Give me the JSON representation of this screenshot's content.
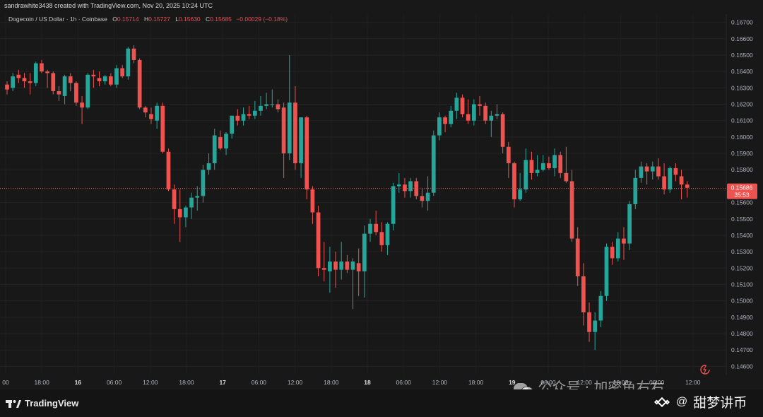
{
  "header": {
    "credit": "sandrawhite3438 created with TradingView.com, Nov 20, 2025 10:24 UTC"
  },
  "legend": {
    "symbol": "Dogecoin / US Dollar · 1h · Coinbase",
    "o_label": "O",
    "o_value": "0.15714",
    "h_label": "H",
    "h_value": "0.15727",
    "l_label": "L",
    "l_value": "0.15630",
    "c_label": "C",
    "c_value": "0.15685",
    "change": "−0.00029 (−0.18%)"
  },
  "price_axis": {
    "ticks": [
      "0.16700",
      "0.16600",
      "0.16500",
      "0.16400",
      "0.16300",
      "0.16200",
      "0.16100",
      "0.16000",
      "0.15900",
      "0.15800",
      "0.15600",
      "0.15500",
      "0.15400",
      "0.15300",
      "0.15200",
      "0.15100",
      "0.15000",
      "0.14900",
      "0.14800",
      "0.14700",
      "0.14600"
    ],
    "current_price": "0.15686",
    "countdown": "35:53"
  },
  "time_axis": {
    "ticks": [
      "00",
      "18:00",
      "16",
      "06:00",
      "12:00",
      "18:00",
      "17",
      "06:00",
      "12:00",
      "18:00",
      "18",
      "06:00",
      "12:00",
      "18:00",
      "19",
      "06:00",
      "12:00",
      "18:00",
      "06:00",
      "12:00"
    ]
  },
  "footer": {
    "brand": "TradingView"
  },
  "watermarks": {
    "wechat_text": "公众号 · 加密鱼右右",
    "channel_text": "甜梦讲币"
  },
  "colors": {
    "up": "#26a69a",
    "down": "#ef5350",
    "background": "#181818",
    "price_line": "#ef5350"
  },
  "chart_data": {
    "type": "candlestick",
    "title": "Dogecoin / US Dollar · 1h · Coinbase",
    "ylim": [
      0.1455,
      0.1675
    ],
    "current_price": 0.15686,
    "series": [
      {
        "ohlc": [
          [
            0.1632,
            0.1634,
            0.1626,
            0.1629
          ],
          [
            0.163,
            0.1639,
            0.1628,
            0.1637
          ],
          [
            0.1638,
            0.1641,
            0.1633,
            0.1636
          ],
          [
            0.1636,
            0.1639,
            0.163,
            0.1634
          ],
          [
            0.1634,
            0.1639,
            0.1626,
            0.1633
          ],
          [
            0.1633,
            0.1646,
            0.1631,
            0.1645
          ],
          [
            0.1645,
            0.1647,
            0.1639,
            0.164
          ],
          [
            0.164,
            0.1641,
            0.163,
            0.1639
          ],
          [
            0.1639,
            0.164,
            0.1626,
            0.1628
          ],
          [
            0.1628,
            0.1631,
            0.1622,
            0.1626
          ],
          [
            0.1625,
            0.1638,
            0.162,
            0.1637
          ],
          [
            0.1637,
            0.1639,
            0.1628,
            0.1633
          ],
          [
            0.1633,
            0.1634,
            0.1619,
            0.1621
          ],
          [
            0.1621,
            0.1625,
            0.1608,
            0.1618
          ],
          [
            0.1618,
            0.1639,
            0.1617,
            0.1638
          ],
          [
            0.1638,
            0.1641,
            0.163,
            0.1637
          ],
          [
            0.1636,
            0.164,
            0.1631,
            0.1634
          ],
          [
            0.1634,
            0.1638,
            0.1632,
            0.1637
          ],
          [
            0.1637,
            0.1639,
            0.1631,
            0.1632
          ],
          [
            0.1632,
            0.1644,
            0.163,
            0.1642
          ],
          [
            0.1642,
            0.1644,
            0.1636,
            0.1637
          ],
          [
            0.1637,
            0.1655,
            0.1635,
            0.1654
          ],
          [
            0.1654,
            0.1656,
            0.1645,
            0.1647
          ],
          [
            0.1647,
            0.1648,
            0.1617,
            0.1618
          ],
          [
            0.1618,
            0.1619,
            0.1612,
            0.1615
          ],
          [
            0.1614,
            0.1618,
            0.1608,
            0.1611
          ],
          [
            0.161,
            0.1621,
            0.1605,
            0.1619
          ],
          [
            0.1619,
            0.1621,
            0.159,
            0.1591
          ],
          [
            0.1591,
            0.1593,
            0.1567,
            0.1568
          ],
          [
            0.1568,
            0.1571,
            0.1547,
            0.1556
          ],
          [
            0.1556,
            0.1568,
            0.1536,
            0.1551
          ],
          [
            0.1551,
            0.1558,
            0.1545,
            0.1557
          ],
          [
            0.1557,
            0.1566,
            0.155,
            0.1563
          ],
          [
            0.1563,
            0.157,
            0.1555,
            0.1564
          ],
          [
            0.1564,
            0.1583,
            0.156,
            0.158
          ],
          [
            0.158,
            0.159,
            0.1577,
            0.1584
          ],
          [
            0.1584,
            0.1605,
            0.158,
            0.1601
          ],
          [
            0.16,
            0.1604,
            0.1592,
            0.1593
          ],
          [
            0.1593,
            0.1603,
            0.1589,
            0.1602
          ],
          [
            0.1602,
            0.1613,
            0.1599,
            0.1613
          ],
          [
            0.1613,
            0.1617,
            0.1607,
            0.161
          ],
          [
            0.161,
            0.1618,
            0.1607,
            0.1614
          ],
          [
            0.1614,
            0.1619,
            0.1611,
            0.1613
          ],
          [
            0.1613,
            0.1622,
            0.1611,
            0.1616
          ],
          [
            0.1616,
            0.1625,
            0.1613,
            0.1619
          ],
          [
            0.1619,
            0.1627,
            0.1617,
            0.162
          ],
          [
            0.162,
            0.1629,
            0.1618,
            0.162
          ],
          [
            0.162,
            0.1623,
            0.1615,
            0.1617
          ],
          [
            0.1618,
            0.1621,
            0.1575,
            0.159
          ],
          [
            0.159,
            0.165,
            0.1586,
            0.1621
          ],
          [
            0.1621,
            0.1631,
            0.158,
            0.1584
          ],
          [
            0.1584,
            0.1612,
            0.1575,
            0.1612
          ],
          [
            0.1612,
            0.1613,
            0.1562,
            0.1568
          ],
          [
            0.1568,
            0.157,
            0.1547,
            0.1554
          ],
          [
            0.1554,
            0.1558,
            0.1515,
            0.152
          ],
          [
            0.152,
            0.1536,
            0.1512,
            0.1519
          ],
          [
            0.1518,
            0.1533,
            0.1505,
            0.1524
          ],
          [
            0.1524,
            0.153,
            0.1508,
            0.1519
          ],
          [
            0.1519,
            0.1536,
            0.1513,
            0.1524
          ],
          [
            0.1524,
            0.1528,
            0.1517,
            0.1519
          ],
          [
            0.1519,
            0.1526,
            0.1495,
            0.1524
          ],
          [
            0.1523,
            0.1532,
            0.1503,
            0.1518
          ],
          [
            0.1518,
            0.1546,
            0.1502,
            0.1541
          ],
          [
            0.1541,
            0.155,
            0.1536,
            0.1547
          ],
          [
            0.1547,
            0.1555,
            0.154,
            0.1542
          ],
          [
            0.1542,
            0.1548,
            0.153,
            0.1534
          ],
          [
            0.1534,
            0.1548,
            0.1528,
            0.1547
          ],
          [
            0.1547,
            0.1572,
            0.1543,
            0.157
          ],
          [
            0.157,
            0.1578,
            0.1566,
            0.1571
          ],
          [
            0.1571,
            0.1575,
            0.1563,
            0.1567
          ],
          [
            0.1567,
            0.1575,
            0.1563,
            0.1573
          ],
          [
            0.1573,
            0.1575,
            0.1562,
            0.1564
          ],
          [
            0.1564,
            0.1569,
            0.1557,
            0.1561
          ],
          [
            0.1561,
            0.1576,
            0.1555,
            0.1566
          ],
          [
            0.1566,
            0.1604,
            0.1564,
            0.1601
          ],
          [
            0.1601,
            0.1615,
            0.1598,
            0.1612
          ],
          [
            0.1612,
            0.1613,
            0.1603,
            0.1608
          ],
          [
            0.1608,
            0.1619,
            0.1606,
            0.1616
          ],
          [
            0.1616,
            0.1627,
            0.1611,
            0.1624
          ],
          [
            0.1624,
            0.1626,
            0.1612,
            0.1614
          ],
          [
            0.1614,
            0.1623,
            0.1608,
            0.161
          ],
          [
            0.161,
            0.1623,
            0.1607,
            0.162
          ],
          [
            0.162,
            0.1625,
            0.1613,
            0.1619
          ],
          [
            0.1619,
            0.1621,
            0.1608,
            0.161
          ],
          [
            0.161,
            0.1616,
            0.16,
            0.1613
          ],
          [
            0.1613,
            0.162,
            0.1611,
            0.1614
          ],
          [
            0.1614,
            0.1615,
            0.159,
            0.1594
          ],
          [
            0.1594,
            0.1597,
            0.1575,
            0.1584
          ],
          [
            0.1584,
            0.1585,
            0.1557,
            0.1562
          ],
          [
            0.1562,
            0.1578,
            0.1561,
            0.1568
          ],
          [
            0.1568,
            0.1593,
            0.1566,
            0.1586
          ],
          [
            0.1586,
            0.1591,
            0.1574,
            0.1578
          ],
          [
            0.1578,
            0.1589,
            0.1576,
            0.158
          ],
          [
            0.158,
            0.1589,
            0.1579,
            0.1584
          ],
          [
            0.1584,
            0.1588,
            0.158,
            0.1581
          ],
          [
            0.1581,
            0.1593,
            0.1576,
            0.1589
          ],
          [
            0.1589,
            0.1591,
            0.1575,
            0.1578
          ],
          [
            0.1578,
            0.1594,
            0.1572,
            0.1573
          ],
          [
            0.1573,
            0.158,
            0.1536,
            0.1538
          ],
          [
            0.1538,
            0.1545,
            0.1509,
            0.1515
          ],
          [
            0.1515,
            0.1523,
            0.1485,
            0.1493
          ],
          [
            0.1493,
            0.1499,
            0.1475,
            0.1481
          ],
          [
            0.1481,
            0.1493,
            0.147,
            0.1488
          ],
          [
            0.1488,
            0.1506,
            0.1484,
            0.1503
          ],
          [
            0.1503,
            0.1535,
            0.15,
            0.1533
          ],
          [
            0.1533,
            0.1536,
            0.1522,
            0.1526
          ],
          [
            0.1526,
            0.1542,
            0.1524,
            0.1538
          ],
          [
            0.1538,
            0.1545,
            0.1525,
            0.1535
          ],
          [
            0.1535,
            0.1561,
            0.1531,
            0.1559
          ],
          [
            0.1559,
            0.158,
            0.1556,
            0.1575
          ],
          [
            0.1575,
            0.1585,
            0.1572,
            0.1582
          ],
          [
            0.1582,
            0.1584,
            0.1571,
            0.1579
          ],
          [
            0.1579,
            0.1585,
            0.1574,
            0.1582
          ],
          [
            0.1582,
            0.1587,
            0.1574,
            0.1576
          ],
          [
            0.1576,
            0.1584,
            0.1565,
            0.1568
          ],
          [
            0.1568,
            0.1582,
            0.1566,
            0.1581
          ],
          [
            0.1581,
            0.1584,
            0.1573,
            0.1577
          ],
          [
            0.1576,
            0.158,
            0.1562,
            0.1571
          ],
          [
            0.1571,
            0.1573,
            0.1563,
            0.1569
          ]
        ]
      }
    ]
  }
}
